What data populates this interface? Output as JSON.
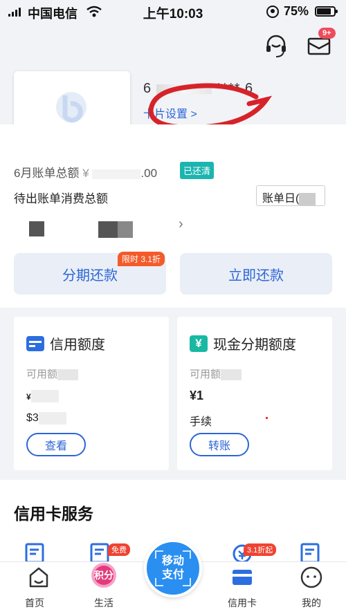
{
  "status_bar": {
    "carrier": "中国电信",
    "time": "上午10:03",
    "battery": "75%"
  },
  "header": {
    "service_icon": "customer-service-icon",
    "mail_icon": "mail-icon",
    "mail_badge": "9+"
  },
  "card": {
    "number_prefix": "6",
    "number_masked": "****",
    "number_suffix": "6",
    "settings_link": "卡片设置 >"
  },
  "bill": {
    "month_total_label": "6月账单总额",
    "month_total_amount_prefix": "¥",
    "month_total_amount_suffix": ".00",
    "paid_badge": "已还清",
    "pending_label": "待出账单消费总额",
    "bill_day_label": "账单日("
  },
  "actions": {
    "installment_label": "分期还款",
    "installment_promo": "限时 3.1折",
    "pay_now_label": "立即还款"
  },
  "credit_panel": {
    "title": "信用额度",
    "icon": "credit-card-icon",
    "available_label": "可用额",
    "amount_prefix": "¥",
    "sub_amount_prefix": "$3",
    "button_label": "查看"
  },
  "cash_panel": {
    "title": "现金分期额度",
    "icon": "yen-icon",
    "available_label": "可用额",
    "amount_prefix": "¥1",
    "fee_label": "手续",
    "button_label": "转账"
  },
  "services": {
    "title": "信用卡服务",
    "badges": [
      "免费",
      "3.1折起"
    ]
  },
  "tabbar": {
    "tabs": [
      {
        "label": "首页",
        "icon": "home-icon"
      },
      {
        "label": "生活",
        "icon": "points-icon",
        "badge_text": "积分"
      },
      {
        "label": "信用卡",
        "icon": "credit-card-tab-icon"
      },
      {
        "label": "我的",
        "icon": "profile-icon"
      }
    ],
    "center_button": "移动支付"
  },
  "colors": {
    "accent_blue": "#2c66d6",
    "teal": "#1bb5b0",
    "promo_orange": "#f35b2b",
    "badge_red": "#ef4b5b"
  }
}
